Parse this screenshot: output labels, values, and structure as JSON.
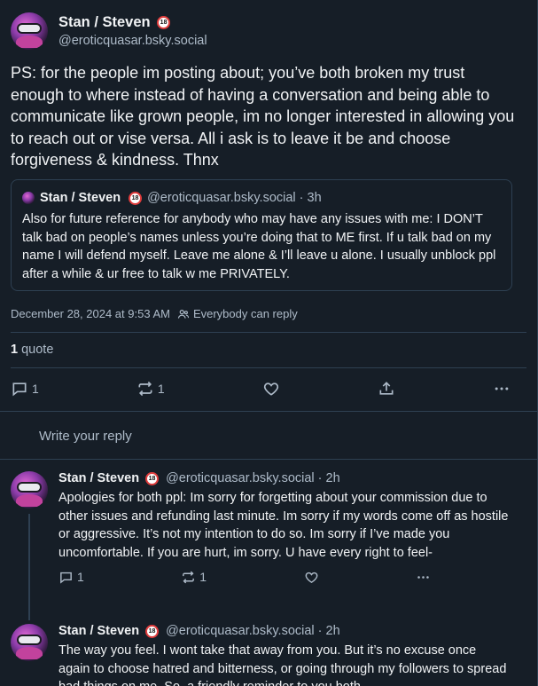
{
  "post": {
    "author": {
      "display_name": "Stan / Steven",
      "badge": "18",
      "handle": "@eroticquasar.bsky.social"
    },
    "text": "PS: for the people im posting about; you’ve both broken my trust enough to where instead of having a conversation and being able to communicate like grown people, im no longer interested in allowing you to reach out or vise versa. All i ask is to leave it be and choose forgiveness & kindness. Thnx",
    "quoted_post": {
      "display_name": "Stan / Steven",
      "badge": "18",
      "handle_time": "@eroticquasar.bsky.social · 3h",
      "text": "Also for future reference for anybody who may have any issues with me: I DON’T talk bad on people’s names unless you’re doing that to ME first. If u talk bad on my name I will defend myself. Leave me alone & I’ll leave u alone. I usually unblock ppl after a while & ur free to talk w me PRIVATELY."
    },
    "timestamp": "December 28, 2024 at 9:53 AM",
    "reply_setting": "Everybody can reply",
    "quote_count": "1",
    "quote_label": "quote",
    "actions": {
      "reply_count": "1",
      "repost_count": "1",
      "like_icon": "heart-icon",
      "share_icon": "share-icon",
      "more_icon": "more-icon"
    }
  },
  "composer": {
    "placeholder": "Write your reply"
  },
  "replies": [
    {
      "display_name": "Stan / Steven",
      "badge": "18",
      "handle_time": "@eroticquasar.bsky.social · 2h",
      "text": "Apologies for both ppl: Im sorry for forgetting about your commission due to other issues and refunding last minute. Im sorry if my words come off as hostile or aggressive. It’s not my intention to do so. Im sorry if I’ve made you uncomfortable. If you are hurt, im sorry. U have every right to feel-",
      "reply_count": "1",
      "repost_count": "1"
    },
    {
      "display_name": "Stan / Steven",
      "badge": "18",
      "handle_time": "@eroticquasar.bsky.social · 2h",
      "text": "The way you feel. I wont take that away from you. But it’s no excuse once again to choose hatred and bitterness, or going through my followers to spread bad things on me. So, a friendly reminder to you both"
    }
  ],
  "colors": {
    "background": "#161e27",
    "border": "#2e4052",
    "text_primary": "#f1f3f5",
    "text_secondary": "#aebbc9",
    "badge_ring": "#e03c3c"
  }
}
